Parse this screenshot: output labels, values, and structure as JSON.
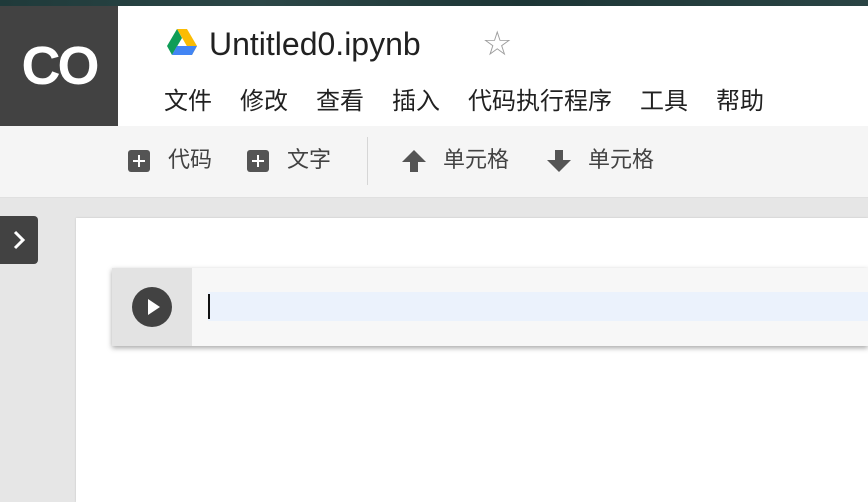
{
  "app": {
    "logo_text": "CO"
  },
  "notebook": {
    "title": "Untitled0.ipynb",
    "star_icon": "star-outline-icon",
    "drive_icon": "google-drive-icon"
  },
  "menu": [
    {
      "label": "文件"
    },
    {
      "label": "修改"
    },
    {
      "label": "查看"
    },
    {
      "label": "插入"
    },
    {
      "label": "代码执行程序"
    },
    {
      "label": "工具"
    },
    {
      "label": "帮助"
    }
  ],
  "toolbar": {
    "add_code_label": "代码",
    "add_text_label": "文字",
    "move_up_label": "单元格",
    "move_down_label": "单元格"
  },
  "cell": {
    "code": ""
  },
  "colors": {
    "dark": "#424242",
    "cell_bg": "#f7f7f7",
    "input_highlight": "#ebf2fc"
  }
}
